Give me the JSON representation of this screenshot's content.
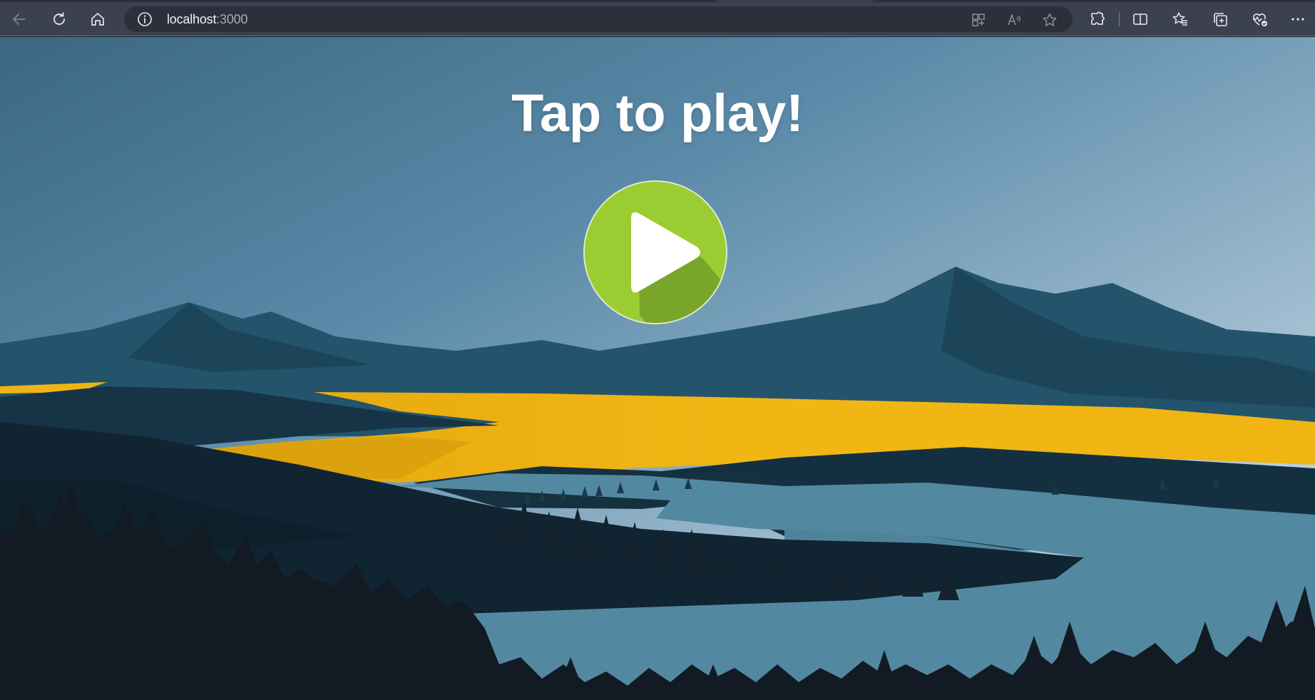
{
  "browser": {
    "url_host": "localhost",
    "url_port": ":3000",
    "icons": {
      "back": "back-arrow-icon",
      "refresh": "refresh-icon",
      "home": "home-icon",
      "site_info": "info-icon",
      "apps": "apps-icon",
      "read_aloud": "read-aloud-icon",
      "favorite": "star-icon",
      "extensions": "puzzle-icon",
      "split_screen": "split-screen-icon",
      "favorites": "favorites-icon",
      "collections": "collections-icon",
      "browser_essentials": "heart-pulse-icon",
      "more": "more-icon"
    }
  },
  "game": {
    "title": "Tap to play!",
    "play_icon": "play-icon",
    "colors": {
      "play_green": "#9acd32",
      "play_shadow": "#7aa52b",
      "sky_top": "#3e6a85",
      "sky_bottom": "#dfe6ec",
      "field_yellow": "#f0b414",
      "mountain": "#1f4a60",
      "forest": "#121a24",
      "river": "#5a8fa5"
    }
  }
}
